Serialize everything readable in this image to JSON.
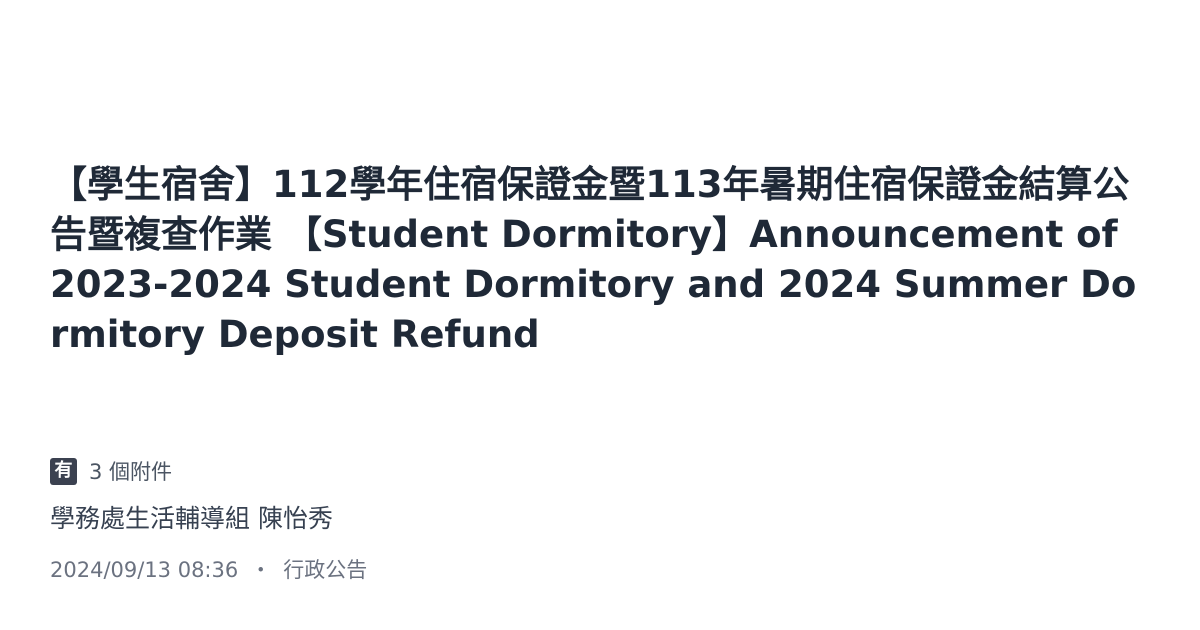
{
  "post": {
    "title": "【學生宿舍】112學年住宿保證金暨113年暑期住宿保證金結算公告暨複查作業 【Student Dormitory】Announcement of 2023-2024 Student Dormitory and 2024 Summer Dormitory Deposit Refund",
    "attachment_badge": "有",
    "attachments_text": "3 個附件",
    "unit": "學務處生活輔導組 陳怡秀",
    "datetime": "2024/09/13 08:36",
    "separator": "・",
    "category": "行政公告"
  },
  "colors": {
    "title": "#1f2937",
    "badge_bg": "#3b4150",
    "meta": "#6b7280"
  }
}
